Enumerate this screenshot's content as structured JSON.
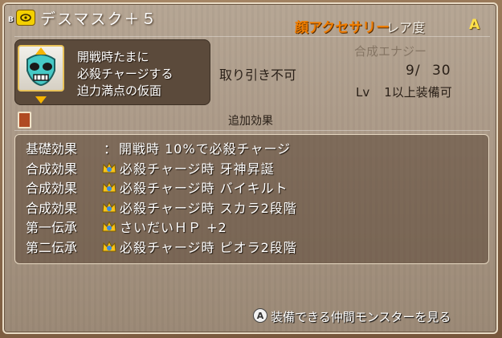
{
  "header": {
    "slot_tag": "B",
    "item_name": "デスマスク＋５",
    "type": "顔アクセサリー",
    "rarity_label": "レア度",
    "rarity_value": "A"
  },
  "description": [
    "開戦時たまに",
    "必殺チャージする",
    "迫力満点の仮面"
  ],
  "info": {
    "synthesis_label": "合成エナジー",
    "no_trade": "取り引き不可",
    "synthesis_value": "9/ 30",
    "level_prefix": "Lv",
    "level_req": "1以上装備可"
  },
  "section_title": "追加効果",
  "effects": [
    {
      "label": "基礎効果",
      "sep": "：",
      "crown": false,
      "text": "開戦時 10%で必殺チャージ"
    },
    {
      "label": "合成効果",
      "sep": "",
      "crown": true,
      "text": "必殺チャージ時 牙神昇誕"
    },
    {
      "label": "合成効果",
      "sep": "",
      "crown": true,
      "text": "必殺チャージ時 バイキルト"
    },
    {
      "label": "合成効果",
      "sep": "",
      "crown": true,
      "text": "必殺チャージ時 スカラ2段階"
    },
    {
      "label": "第一伝承",
      "sep": "",
      "crown": true,
      "text": "さいだいＨＰ +2"
    },
    {
      "label": "第二伝承",
      "sep": "",
      "crown": true,
      "text": "必殺チャージ時 ピオラ2段階"
    }
  ],
  "footer": {
    "button": "A",
    "text": "装備できる仲間モンスターを見る"
  },
  "colors": {
    "type_accent": "#f07d00",
    "rarity_accent": "#ffe14a",
    "crown": "#3a8be0"
  }
}
